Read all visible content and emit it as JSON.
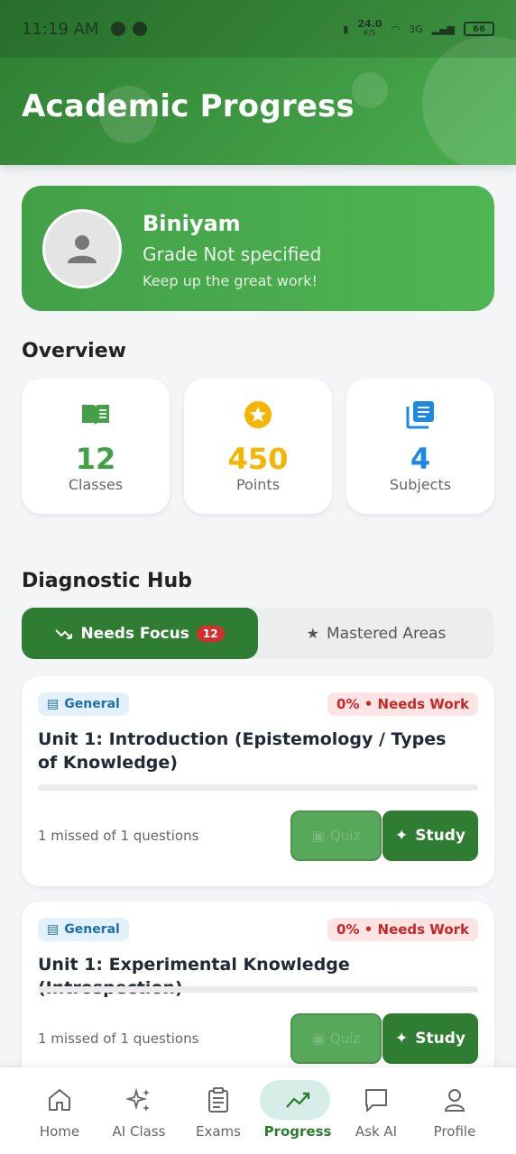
{
  "status_bar": {
    "time": "11:19 AM",
    "net_speed": "24.0",
    "net_unit": "K/S",
    "network": "3G",
    "battery": "66"
  },
  "header": {
    "title": "Academic Progress"
  },
  "profile": {
    "name": "Biniyam",
    "grade": "Grade Not specified",
    "message": "Keep up the great work!"
  },
  "overview": {
    "title": "Overview",
    "stats": [
      {
        "value": "12",
        "label": "Classes",
        "icon": "book-open-icon",
        "color": "#43a047"
      },
      {
        "value": "450",
        "label": "Points",
        "icon": "star-badge-icon",
        "color": "#f4b400"
      },
      {
        "value": "4",
        "label": "Subjects",
        "icon": "library-icon",
        "color": "#1e88e5"
      }
    ]
  },
  "diagnostic": {
    "title": "Diagnostic Hub",
    "tabs": [
      {
        "label": "Needs Focus",
        "badge": "12",
        "icon": "trending-down-icon"
      },
      {
        "label": "Mastered Areas",
        "icon": "star-icon"
      }
    ],
    "cards": [
      {
        "subject": "General",
        "status": "0% • Needs Work",
        "title": "Unit 1: Introduction (Epistemology / Types of Knowledge)",
        "missed": "1 missed of 1 questions",
        "quiz": "Quiz",
        "study": "Study",
        "progress": 0
      },
      {
        "subject": "General",
        "status": "0% • Needs Work",
        "title": "Unit 1: Experimental Knowledge (Introspection)",
        "missed": "1 missed of 1 questions",
        "quiz": "Quiz",
        "study": "Study",
        "progress": 0
      }
    ]
  },
  "nav": [
    {
      "label": "Home",
      "icon": "home-icon"
    },
    {
      "label": "AI Class",
      "icon": "sparkles-icon"
    },
    {
      "label": "Exams",
      "icon": "clipboard-icon"
    },
    {
      "label": "Progress",
      "icon": "trend-icon",
      "active": true
    },
    {
      "label": "Ask AI",
      "icon": "chat-icon"
    },
    {
      "label": "Profile",
      "icon": "person-icon"
    }
  ],
  "colors": {
    "primary": "#2e7d32",
    "accent": "#43a047",
    "danger": "#c62828",
    "info": "#1e6fb0"
  }
}
